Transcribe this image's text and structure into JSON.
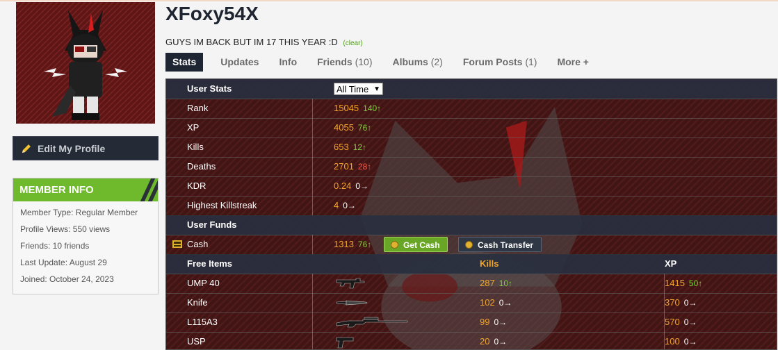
{
  "profile": {
    "username": "XFoxy54X",
    "status": "GUYS IM BACK BUT IM 17 THIS YEAR :D",
    "status_clear": "(clear)"
  },
  "sidebar": {
    "edit_profile": "Edit My Profile",
    "member_info_title": "MEMBER INFO",
    "member_info": [
      "Member Type: Regular Member",
      "Profile Views: 550 views",
      "Friends: 10 friends",
      "Last Update: August 29",
      "Joined: October 24, 2023"
    ]
  },
  "tabs": [
    {
      "label": "Stats",
      "count": ""
    },
    {
      "label": "Updates",
      "count": ""
    },
    {
      "label": "Info",
      "count": ""
    },
    {
      "label": "Friends",
      "count": "(10)"
    },
    {
      "label": "Albums",
      "count": "(2)"
    },
    {
      "label": "Forum Posts",
      "count": "(1)"
    },
    {
      "label": "More +",
      "count": ""
    }
  ],
  "stats": {
    "section_title": "User Stats",
    "period": "All Time",
    "rows": [
      {
        "label": "Rank",
        "value": "15045",
        "delta": "140↑",
        "trend": "up"
      },
      {
        "label": "XP",
        "value": "4055",
        "delta": "76↑",
        "trend": "up"
      },
      {
        "label": "Kills",
        "value": "653",
        "delta": "12↑",
        "trend": "up"
      },
      {
        "label": "Deaths",
        "value": "2701",
        "delta": "28↑",
        "trend": "down"
      },
      {
        "label": "KDR",
        "value": "0.24",
        "delta": "0→",
        "trend": "same"
      },
      {
        "label": "Highest Killstreak",
        "value": "4",
        "delta": "0→",
        "trend": "same"
      }
    ]
  },
  "funds": {
    "section_title": "User Funds",
    "cash_label": "Cash",
    "cash_value": "1313",
    "cash_delta": "76↑",
    "get_cash": "Get Cash",
    "cash_transfer": "Cash Transfer"
  },
  "items": {
    "section_title": "Free Items",
    "col_kills": "Kills",
    "col_xp": "XP",
    "rows": [
      {
        "name": "UMP 40",
        "icon": "smg-icon",
        "kills": "287",
        "kills_delta": "10↑",
        "kills_trend": "up",
        "xp": "1415",
        "xp_delta": "50↑",
        "xp_trend": "up"
      },
      {
        "name": "Knife",
        "icon": "knife-icon",
        "kills": "102",
        "kills_delta": "0→",
        "kills_trend": "same",
        "xp": "370",
        "xp_delta": "0→",
        "xp_trend": "same"
      },
      {
        "name": "L115A3",
        "icon": "sniper-rifle-icon",
        "kills": "99",
        "kills_delta": "0→",
        "kills_trend": "same",
        "xp": "570",
        "xp_delta": "0→",
        "xp_trend": "same"
      },
      {
        "name": "USP",
        "icon": "pistol-icon",
        "kills": "20",
        "kills_delta": "0→",
        "kills_trend": "same",
        "xp": "100",
        "xp_delta": "0→",
        "xp_trend": "same"
      }
    ]
  },
  "colors": {
    "accent_green": "#6fba2c",
    "value_orange": "#f3a42a",
    "header_dark": "#1f2633"
  }
}
